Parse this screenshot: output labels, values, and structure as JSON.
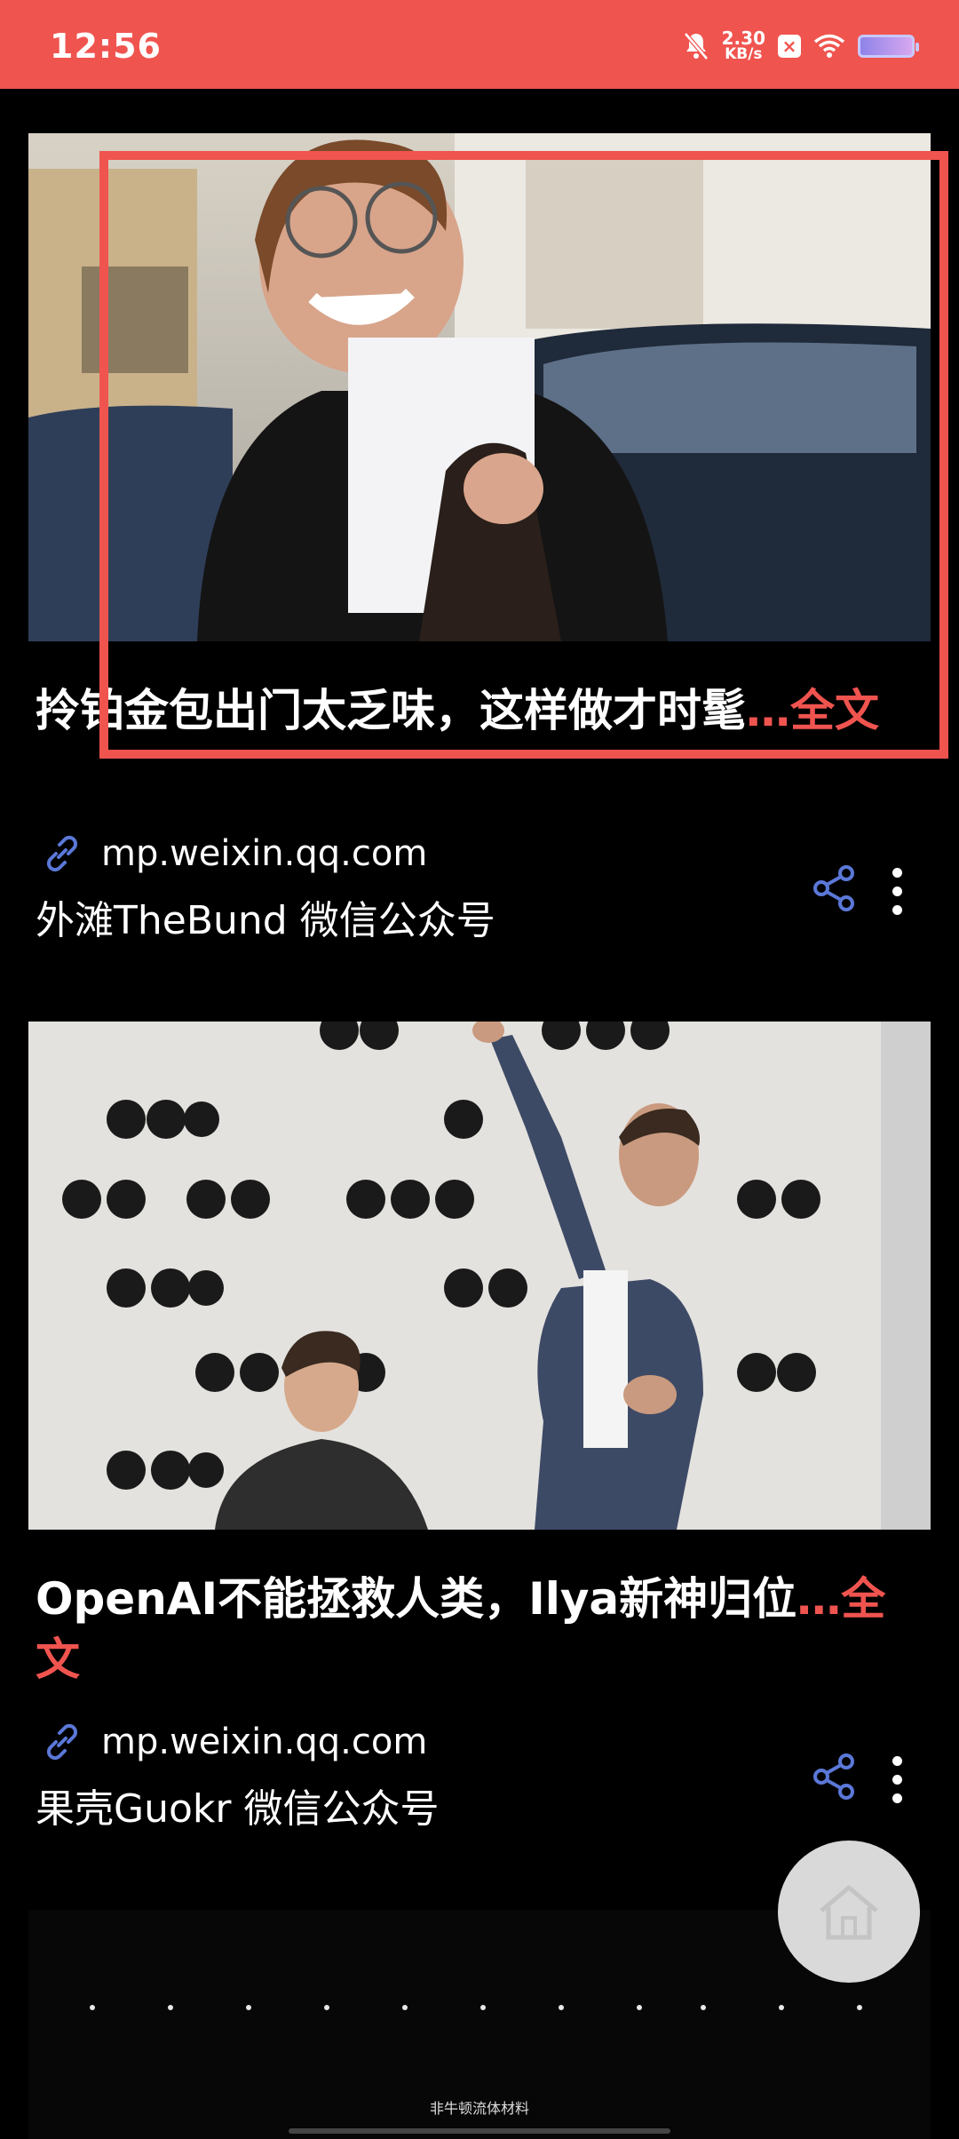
{
  "status_bar": {
    "time": "12:56",
    "net_speed": "2.30",
    "net_unit": "KB/s"
  },
  "articles": [
    {
      "title": "拎铂金包出门太乏味，这样做才时髦",
      "more": "…全文",
      "url": "mp.weixin.qq.com",
      "source": "外滩TheBund 微信公众号"
    },
    {
      "title": "OpenAI不能拯救人类，Ilya新神归位",
      "more": "…全文",
      "url": "mp.weixin.qq.com",
      "source": "果壳Guokr 微信公众号"
    }
  ],
  "bottom_card": {
    "credit": "非牛顿流体材料"
  },
  "colors": {
    "accent": "#f0544f",
    "link_icon": "#5b78d8"
  }
}
